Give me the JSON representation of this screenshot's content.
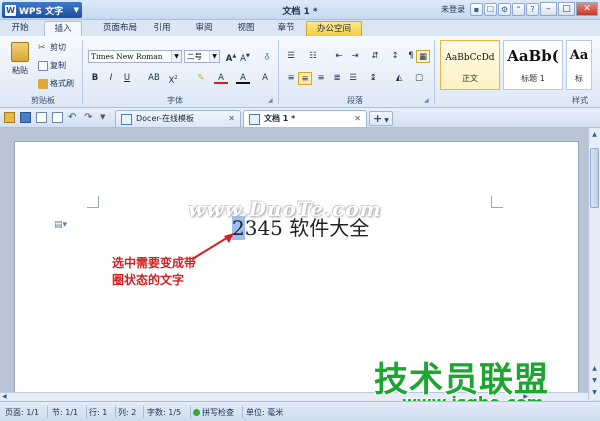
{
  "app": {
    "name": "WPS 文字",
    "doc_title": "文档 1 *",
    "login": "未登录"
  },
  "tabs": [
    "开始",
    "插入",
    "页面布局",
    "引用",
    "审阅",
    "视图",
    "章节",
    "办公空间"
  ],
  "ribbon": {
    "clipboard": {
      "paste": "粘贴",
      "cut": "剪切",
      "copy": "复制",
      "format_painter": "格式刷",
      "group": "剪贴板"
    },
    "font": {
      "name": "Times New Roman",
      "size": "二号",
      "group": "字体"
    },
    "paragraph": {
      "group": "段落"
    },
    "styles": {
      "group": "样式",
      "items": [
        {
          "sample": "AaBbCcDd",
          "name": "正文"
        },
        {
          "sample": "AaBb(",
          "name": "标题 1"
        },
        {
          "sample": "Aa",
          "name": "标"
        }
      ]
    }
  },
  "doc_tabs": [
    {
      "label": "Docer-在线模板",
      "active": false
    },
    {
      "label": "文档 1 *",
      "active": true
    }
  ],
  "document": {
    "text_selected": "2",
    "text_rest": "345 软件大全",
    "watermark": "www.DuoTe.com"
  },
  "annotation": {
    "line1": "选中需要变成带",
    "line2": "圈状态的文字"
  },
  "status": {
    "page": "页面: 1/1",
    "section": "节: 1/1",
    "row": "行: 1",
    "col": "列: 2",
    "words": "字数: 1/5",
    "spell": "拼写检查",
    "unit": "单位: 毫米"
  },
  "branding": {
    "name": "技术员联盟",
    "url": "www.jsgho.com"
  }
}
